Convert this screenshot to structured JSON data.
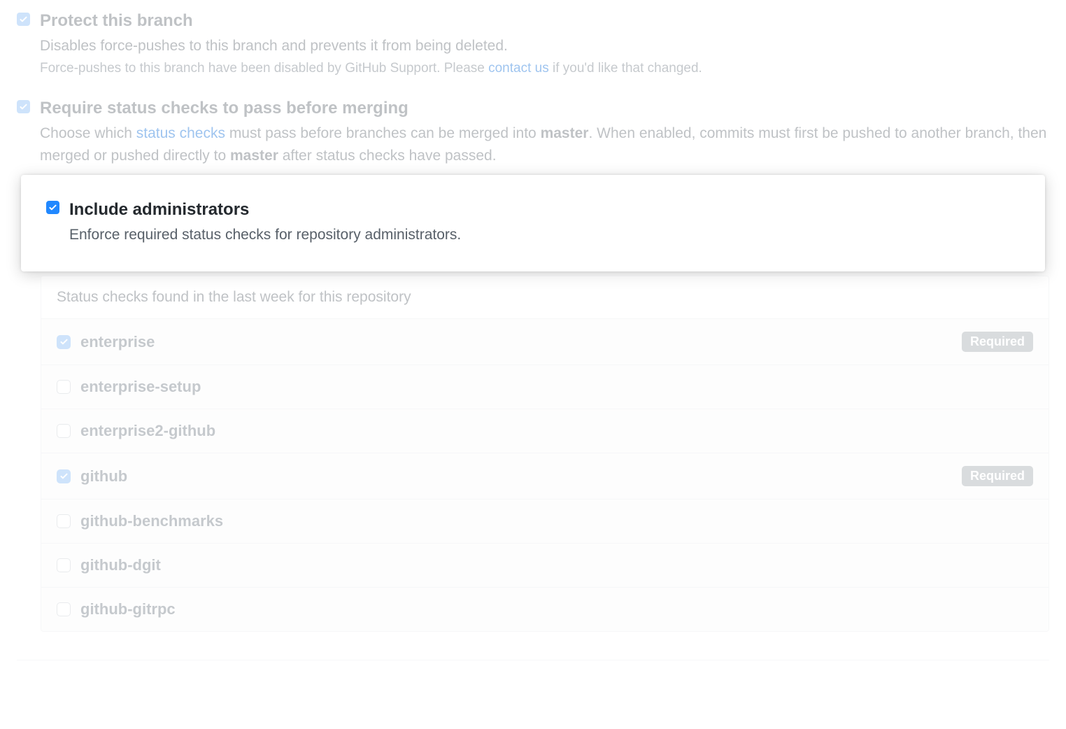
{
  "protect": {
    "title": "Protect this branch",
    "desc": "Disables force-pushes to this branch and prevents it from being deleted.",
    "note_prefix": "Force-pushes to this branch have been disabled by GitHub Support. Please ",
    "note_link": "contact us",
    "note_suffix": " if you'd like that changed.",
    "checked": true
  },
  "require_checks": {
    "title": "Require status checks to pass before merging",
    "desc_1": "Choose which ",
    "desc_link": "status checks",
    "desc_2": " must pass before branches can be merged into ",
    "desc_branch1": "master",
    "desc_3": ". When enabled, commits must first be pushed to another branch, then merged or pushed directly to ",
    "desc_branch2": "master",
    "desc_4": " after status checks have passed.",
    "checked": true
  },
  "include_admins": {
    "title": "Include administrators",
    "desc": "Enforce required status checks for repository administrators.",
    "checked": true
  },
  "checks_header": "Status checks found in the last week for this repository",
  "required_label": "Required",
  "checks": [
    {
      "name": "enterprise",
      "checked": true,
      "required": true
    },
    {
      "name": "enterprise-setup",
      "checked": false,
      "required": false
    },
    {
      "name": "enterprise2-github",
      "checked": false,
      "required": false
    },
    {
      "name": "github",
      "checked": true,
      "required": true
    },
    {
      "name": "github-benchmarks",
      "checked": false,
      "required": false
    },
    {
      "name": "github-dgit",
      "checked": false,
      "required": false
    },
    {
      "name": "github-gitrpc",
      "checked": false,
      "required": false
    }
  ]
}
